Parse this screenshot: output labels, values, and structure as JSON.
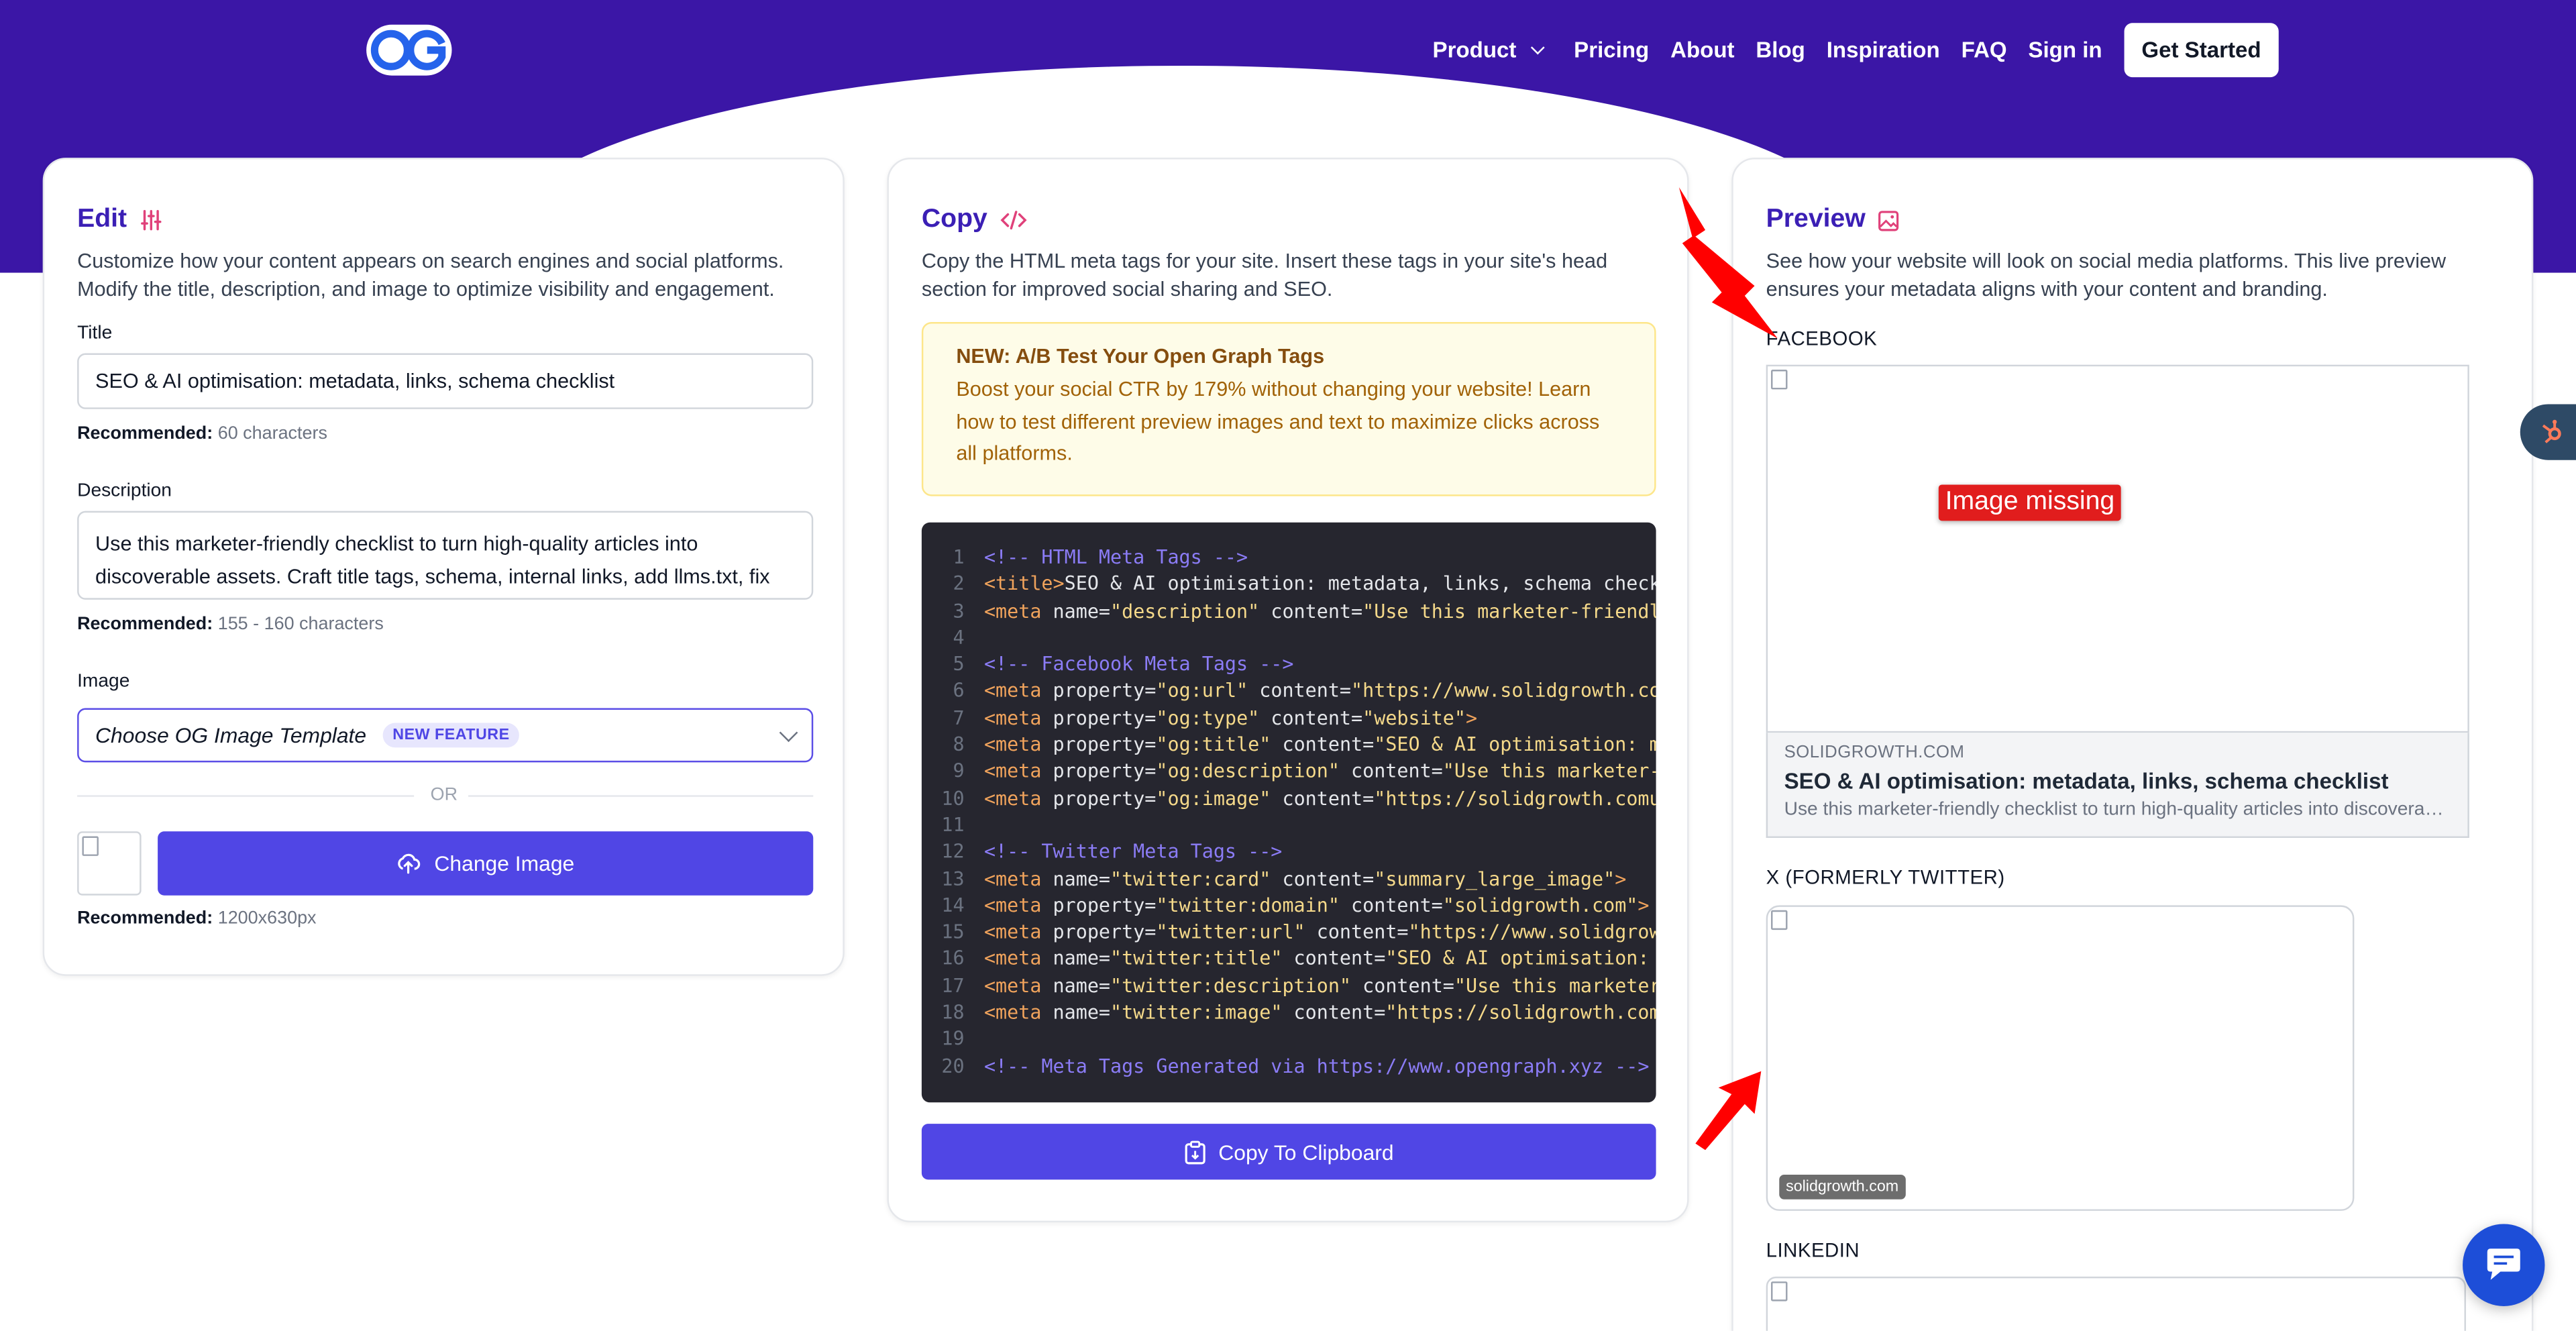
{
  "nav": {
    "logo_text": "OG",
    "items": [
      "Product",
      "Pricing",
      "About",
      "Blog",
      "Inspiration",
      "FAQ",
      "Sign in"
    ],
    "cta": "Get Started"
  },
  "edit": {
    "heading": "Edit",
    "description": "Customize how your content appears on search engines and social platforms. Modify the title, description, and image to optimize visibility and engagement.",
    "title_label": "Title",
    "title_value": "SEO & AI optimisation: metadata, links, schema checklist",
    "title_hint_label": "Recommended:",
    "title_hint_value": "60 characters",
    "description_label": "Description",
    "description_value": "Use this marketer-friendly checklist to turn high-quality articles into discoverable assets. Craft title tags, schema, internal links, add llms.txt, fix",
    "description_hint_label": "Recommended:",
    "description_hint_value": "155 - 160 characters",
    "image_label": "Image",
    "image_select": "Choose OG Image Template",
    "image_badge": "NEW FEATURE",
    "or_text": "OR",
    "change_image": "Change Image",
    "image_hint_label": "Recommended:",
    "image_hint_value": "1200x630px"
  },
  "copy": {
    "heading": "Copy",
    "description": "Copy the HTML meta tags for your site. Insert these tags in your site's head section for improved social sharing and SEO.",
    "notice_title": "NEW: A/B Test Your Open Graph Tags",
    "notice_body": "Boost your social CTR by 179% without changing your website! Learn how to test different preview images and text to maximize clicks across all platforms.",
    "copy_button": "Copy To Clipboard",
    "code_lines": [
      [
        [
          "c-com",
          "<!-- HTML Meta Tags -->"
        ]
      ],
      [
        [
          "c-tag",
          "<title>"
        ],
        [
          "c-attr",
          "SEO & AI optimisation: metadata, links, schema check"
        ]
      ],
      [
        [
          "c-tag",
          "<meta "
        ],
        [
          "c-attr",
          "name="
        ],
        [
          "c-str",
          "\"description\""
        ],
        [
          "c-attr",
          " content="
        ],
        [
          "c-str",
          "\"Use this marketer-friendl"
        ]
      ],
      [],
      [
        [
          "c-com",
          "<!-- Facebook Meta Tags -->"
        ]
      ],
      [
        [
          "c-tag",
          "<meta "
        ],
        [
          "c-attr",
          "property="
        ],
        [
          "c-str",
          "\"og:url\""
        ],
        [
          "c-attr",
          " content="
        ],
        [
          "c-str",
          "\"https://www.solidgrowth.co"
        ]
      ],
      [
        [
          "c-tag",
          "<meta "
        ],
        [
          "c-attr",
          "property="
        ],
        [
          "c-str",
          "\"og:type\""
        ],
        [
          "c-attr",
          " content="
        ],
        [
          "c-str",
          "\"website\""
        ],
        [
          "c-tag",
          ">"
        ]
      ],
      [
        [
          "c-tag",
          "<meta "
        ],
        [
          "c-attr",
          "property="
        ],
        [
          "c-str",
          "\"og:title\""
        ],
        [
          "c-attr",
          " content="
        ],
        [
          "c-str",
          "\"SEO & AI optimisation: m"
        ]
      ],
      [
        [
          "c-tag",
          "<meta "
        ],
        [
          "c-attr",
          "property="
        ],
        [
          "c-str",
          "\"og:description\""
        ],
        [
          "c-attr",
          " content="
        ],
        [
          "c-str",
          "\"Use this marketer-"
        ]
      ],
      [
        [
          "c-tag",
          "<meta "
        ],
        [
          "c-attr",
          "property="
        ],
        [
          "c-str",
          "\"og:image\""
        ],
        [
          "c-attr",
          " content="
        ],
        [
          "c-str",
          "\"https://solidgrowth.comu"
        ]
      ],
      [],
      [
        [
          "c-com",
          "<!-- Twitter Meta Tags -->"
        ]
      ],
      [
        [
          "c-tag",
          "<meta "
        ],
        [
          "c-attr",
          "name="
        ],
        [
          "c-str",
          "\"twitter:card\""
        ],
        [
          "c-attr",
          " content="
        ],
        [
          "c-str",
          "\"summary_large_image\""
        ],
        [
          "c-tag",
          ">"
        ]
      ],
      [
        [
          "c-tag",
          "<meta "
        ],
        [
          "c-attr",
          "property="
        ],
        [
          "c-str",
          "\"twitter:domain\""
        ],
        [
          "c-attr",
          " content="
        ],
        [
          "c-str",
          "\"solidgrowth.com\""
        ],
        [
          "c-tag",
          ">"
        ]
      ],
      [
        [
          "c-tag",
          "<meta "
        ],
        [
          "c-attr",
          "property="
        ],
        [
          "c-str",
          "\"twitter:url\""
        ],
        [
          "c-attr",
          " content="
        ],
        [
          "c-str",
          "\"https://www.solidgrow"
        ]
      ],
      [
        [
          "c-tag",
          "<meta "
        ],
        [
          "c-attr",
          "name="
        ],
        [
          "c-str",
          "\"twitter:title\""
        ],
        [
          "c-attr",
          " content="
        ],
        [
          "c-str",
          "\"SEO & AI optimisation: "
        ]
      ],
      [
        [
          "c-tag",
          "<meta "
        ],
        [
          "c-attr",
          "name="
        ],
        [
          "c-str",
          "\"twitter:description\""
        ],
        [
          "c-attr",
          " content="
        ],
        [
          "c-str",
          "\"Use this marketer"
        ]
      ],
      [
        [
          "c-tag",
          "<meta "
        ],
        [
          "c-attr",
          "name="
        ],
        [
          "c-str",
          "\"twitter:image\""
        ],
        [
          "c-attr",
          " content="
        ],
        [
          "c-str",
          "\"https://solidgrowth.com"
        ]
      ],
      [],
      [
        [
          "c-com",
          "<!-- Meta Tags Generated via https://www.opengraph.xyz -->"
        ]
      ]
    ]
  },
  "preview": {
    "heading": "Preview",
    "description": "See how your website will look on social media platforms. This live preview ensures your metadata aligns with your content and branding.",
    "facebook_label": "FACEBOOK",
    "image_missing": "Image missing",
    "fb_domain": "SOLIDGROWTH.COM",
    "fb_title": "SEO & AI optimisation: metadata, links, schema checklist",
    "fb_desc": "Use this marketer-friendly checklist to turn high-quality articles into discoverable assets. Craft title tags, schema, internal links, add llms.txt, fix",
    "x_label": "X (FORMERLY TWITTER)",
    "x_domain": "solidgrowth.com",
    "linkedin_label": "LINKEDIN"
  },
  "colors": {
    "brand": "#3b16a6",
    "primary_button": "#5046e5",
    "heading": "#3b1fb5",
    "annotation_arrow": "#ff0000"
  },
  "icons": [
    "sliders-icon",
    "code-icon",
    "image-icon",
    "upload-icon",
    "clipboard-icon",
    "hubspot-icon",
    "chat-icon",
    "chevron-down-icon"
  ]
}
